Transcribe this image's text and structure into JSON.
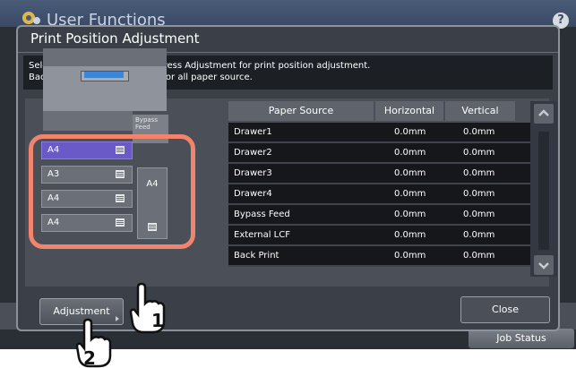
{
  "app": {
    "title": "User Functions",
    "help_label": "?",
    "job_status": "Job Status"
  },
  "dialog": {
    "title": "Print Position Adjustment",
    "message_line1": "Select the paper source and press Adjustment for print position adjustment.",
    "message_line2": "Back Print is common setting for all paper source."
  },
  "machine": {
    "bypass_label_1": "Bypass",
    "bypass_label_2": "Feed",
    "trays": [
      "A4",
      "A3",
      "A4",
      "A4"
    ],
    "bypass_size": "A4"
  },
  "table": {
    "headers": [
      "Paper Source",
      "Horizontal",
      "Vertical"
    ],
    "rows": [
      [
        "Drawer1",
        "0.0mm",
        "0.0mm"
      ],
      [
        "Drawer2",
        "0.0mm",
        "0.0mm"
      ],
      [
        "Drawer3",
        "0.0mm",
        "0.0mm"
      ],
      [
        "Drawer4",
        "0.0mm",
        "0.0mm"
      ],
      [
        "Bypass Feed",
        "0.0mm",
        "0.0mm"
      ],
      [
        "External LCF",
        "0.0mm",
        "0.0mm"
      ],
      [
        "Back Print",
        "0.0mm",
        "0.0mm"
      ]
    ]
  },
  "buttons": {
    "adjustment": "Adjustment",
    "close": "Close"
  },
  "steps": {
    "step1": "1",
    "step2": "2"
  },
  "colors": {
    "highlight_ring": "#f0846c",
    "selected_tray": "#6a5ac8",
    "screen_blue": "#3b86d9"
  }
}
